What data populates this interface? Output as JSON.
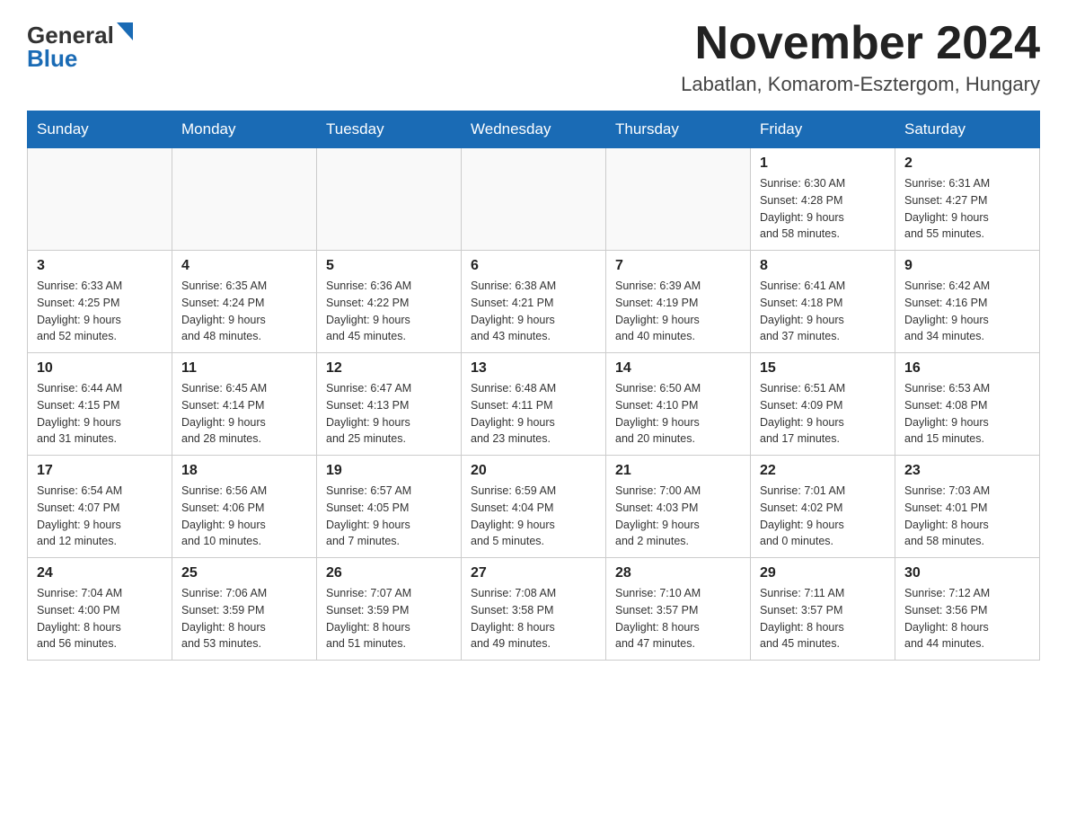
{
  "header": {
    "logo": {
      "general": "General",
      "blue": "Blue"
    },
    "title": "November 2024",
    "location": "Labatlan, Komarom-Esztergom, Hungary"
  },
  "weekdays": [
    "Sunday",
    "Monday",
    "Tuesday",
    "Wednesday",
    "Thursday",
    "Friday",
    "Saturday"
  ],
  "weeks": [
    [
      {
        "day": "",
        "info": ""
      },
      {
        "day": "",
        "info": ""
      },
      {
        "day": "",
        "info": ""
      },
      {
        "day": "",
        "info": ""
      },
      {
        "day": "",
        "info": ""
      },
      {
        "day": "1",
        "info": "Sunrise: 6:30 AM\nSunset: 4:28 PM\nDaylight: 9 hours\nand 58 minutes."
      },
      {
        "day": "2",
        "info": "Sunrise: 6:31 AM\nSunset: 4:27 PM\nDaylight: 9 hours\nand 55 minutes."
      }
    ],
    [
      {
        "day": "3",
        "info": "Sunrise: 6:33 AM\nSunset: 4:25 PM\nDaylight: 9 hours\nand 52 minutes."
      },
      {
        "day": "4",
        "info": "Sunrise: 6:35 AM\nSunset: 4:24 PM\nDaylight: 9 hours\nand 48 minutes."
      },
      {
        "day": "5",
        "info": "Sunrise: 6:36 AM\nSunset: 4:22 PM\nDaylight: 9 hours\nand 45 minutes."
      },
      {
        "day": "6",
        "info": "Sunrise: 6:38 AM\nSunset: 4:21 PM\nDaylight: 9 hours\nand 43 minutes."
      },
      {
        "day": "7",
        "info": "Sunrise: 6:39 AM\nSunset: 4:19 PM\nDaylight: 9 hours\nand 40 minutes."
      },
      {
        "day": "8",
        "info": "Sunrise: 6:41 AM\nSunset: 4:18 PM\nDaylight: 9 hours\nand 37 minutes."
      },
      {
        "day": "9",
        "info": "Sunrise: 6:42 AM\nSunset: 4:16 PM\nDaylight: 9 hours\nand 34 minutes."
      }
    ],
    [
      {
        "day": "10",
        "info": "Sunrise: 6:44 AM\nSunset: 4:15 PM\nDaylight: 9 hours\nand 31 minutes."
      },
      {
        "day": "11",
        "info": "Sunrise: 6:45 AM\nSunset: 4:14 PM\nDaylight: 9 hours\nand 28 minutes."
      },
      {
        "day": "12",
        "info": "Sunrise: 6:47 AM\nSunset: 4:13 PM\nDaylight: 9 hours\nand 25 minutes."
      },
      {
        "day": "13",
        "info": "Sunrise: 6:48 AM\nSunset: 4:11 PM\nDaylight: 9 hours\nand 23 minutes."
      },
      {
        "day": "14",
        "info": "Sunrise: 6:50 AM\nSunset: 4:10 PM\nDaylight: 9 hours\nand 20 minutes."
      },
      {
        "day": "15",
        "info": "Sunrise: 6:51 AM\nSunset: 4:09 PM\nDaylight: 9 hours\nand 17 minutes."
      },
      {
        "day": "16",
        "info": "Sunrise: 6:53 AM\nSunset: 4:08 PM\nDaylight: 9 hours\nand 15 minutes."
      }
    ],
    [
      {
        "day": "17",
        "info": "Sunrise: 6:54 AM\nSunset: 4:07 PM\nDaylight: 9 hours\nand 12 minutes."
      },
      {
        "day": "18",
        "info": "Sunrise: 6:56 AM\nSunset: 4:06 PM\nDaylight: 9 hours\nand 10 minutes."
      },
      {
        "day": "19",
        "info": "Sunrise: 6:57 AM\nSunset: 4:05 PM\nDaylight: 9 hours\nand 7 minutes."
      },
      {
        "day": "20",
        "info": "Sunrise: 6:59 AM\nSunset: 4:04 PM\nDaylight: 9 hours\nand 5 minutes."
      },
      {
        "day": "21",
        "info": "Sunrise: 7:00 AM\nSunset: 4:03 PM\nDaylight: 9 hours\nand 2 minutes."
      },
      {
        "day": "22",
        "info": "Sunrise: 7:01 AM\nSunset: 4:02 PM\nDaylight: 9 hours\nand 0 minutes."
      },
      {
        "day": "23",
        "info": "Sunrise: 7:03 AM\nSunset: 4:01 PM\nDaylight: 8 hours\nand 58 minutes."
      }
    ],
    [
      {
        "day": "24",
        "info": "Sunrise: 7:04 AM\nSunset: 4:00 PM\nDaylight: 8 hours\nand 56 minutes."
      },
      {
        "day": "25",
        "info": "Sunrise: 7:06 AM\nSunset: 3:59 PM\nDaylight: 8 hours\nand 53 minutes."
      },
      {
        "day": "26",
        "info": "Sunrise: 7:07 AM\nSunset: 3:59 PM\nDaylight: 8 hours\nand 51 minutes."
      },
      {
        "day": "27",
        "info": "Sunrise: 7:08 AM\nSunset: 3:58 PM\nDaylight: 8 hours\nand 49 minutes."
      },
      {
        "day": "28",
        "info": "Sunrise: 7:10 AM\nSunset: 3:57 PM\nDaylight: 8 hours\nand 47 minutes."
      },
      {
        "day": "29",
        "info": "Sunrise: 7:11 AM\nSunset: 3:57 PM\nDaylight: 8 hours\nand 45 minutes."
      },
      {
        "day": "30",
        "info": "Sunrise: 7:12 AM\nSunset: 3:56 PM\nDaylight: 8 hours\nand 44 minutes."
      }
    ]
  ]
}
